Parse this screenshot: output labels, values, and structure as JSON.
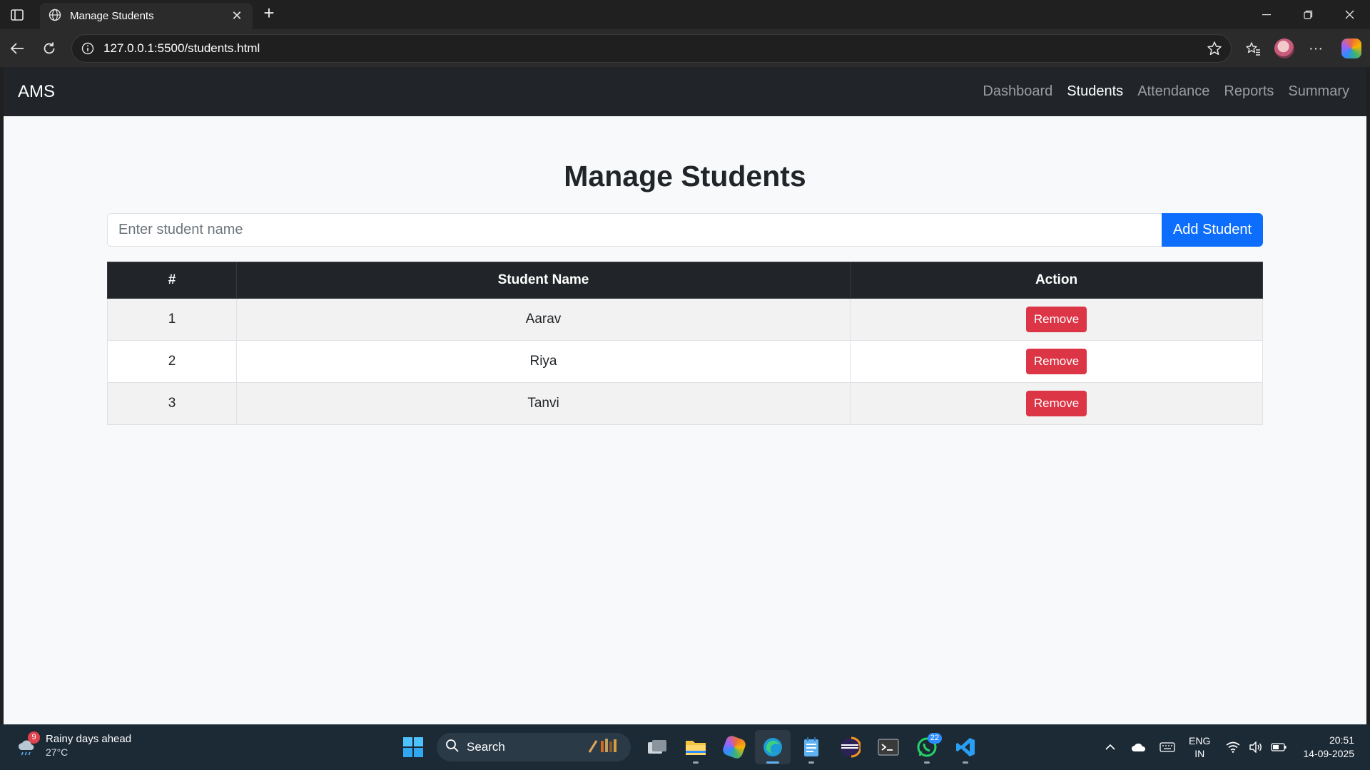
{
  "browser": {
    "tab_title": "Manage Students",
    "url": "127.0.0.1:5500/students.html"
  },
  "app": {
    "brand": "AMS",
    "nav": [
      {
        "label": "Dashboard",
        "active": false
      },
      {
        "label": "Students",
        "active": true
      },
      {
        "label": "Attendance",
        "active": false
      },
      {
        "label": "Reports",
        "active": false
      },
      {
        "label": "Summary",
        "active": false
      }
    ],
    "page_title": "Manage Students",
    "add_form": {
      "placeholder": "Enter student name",
      "value": "",
      "button_label": "Add Student"
    },
    "table": {
      "headers": [
        "#",
        "Student Name",
        "Action"
      ],
      "rows": [
        {
          "index": "1",
          "name": "Aarav",
          "action": "Remove"
        },
        {
          "index": "2",
          "name": "Riya",
          "action": "Remove"
        },
        {
          "index": "3",
          "name": "Tanvi",
          "action": "Remove"
        }
      ]
    }
  },
  "taskbar": {
    "weather": {
      "badge": "9",
      "title": "Rainy days ahead",
      "temp": "27°C"
    },
    "search_label": "Search",
    "whatsapp_badge": "22",
    "lang_line1": "ENG",
    "lang_line2": "IN",
    "time": "20:51",
    "date": "14-09-2025"
  },
  "colors": {
    "navbar": "#212529",
    "primary": "#0d6efd",
    "danger": "#dc3545",
    "page_bg": "#f8f9fa"
  }
}
